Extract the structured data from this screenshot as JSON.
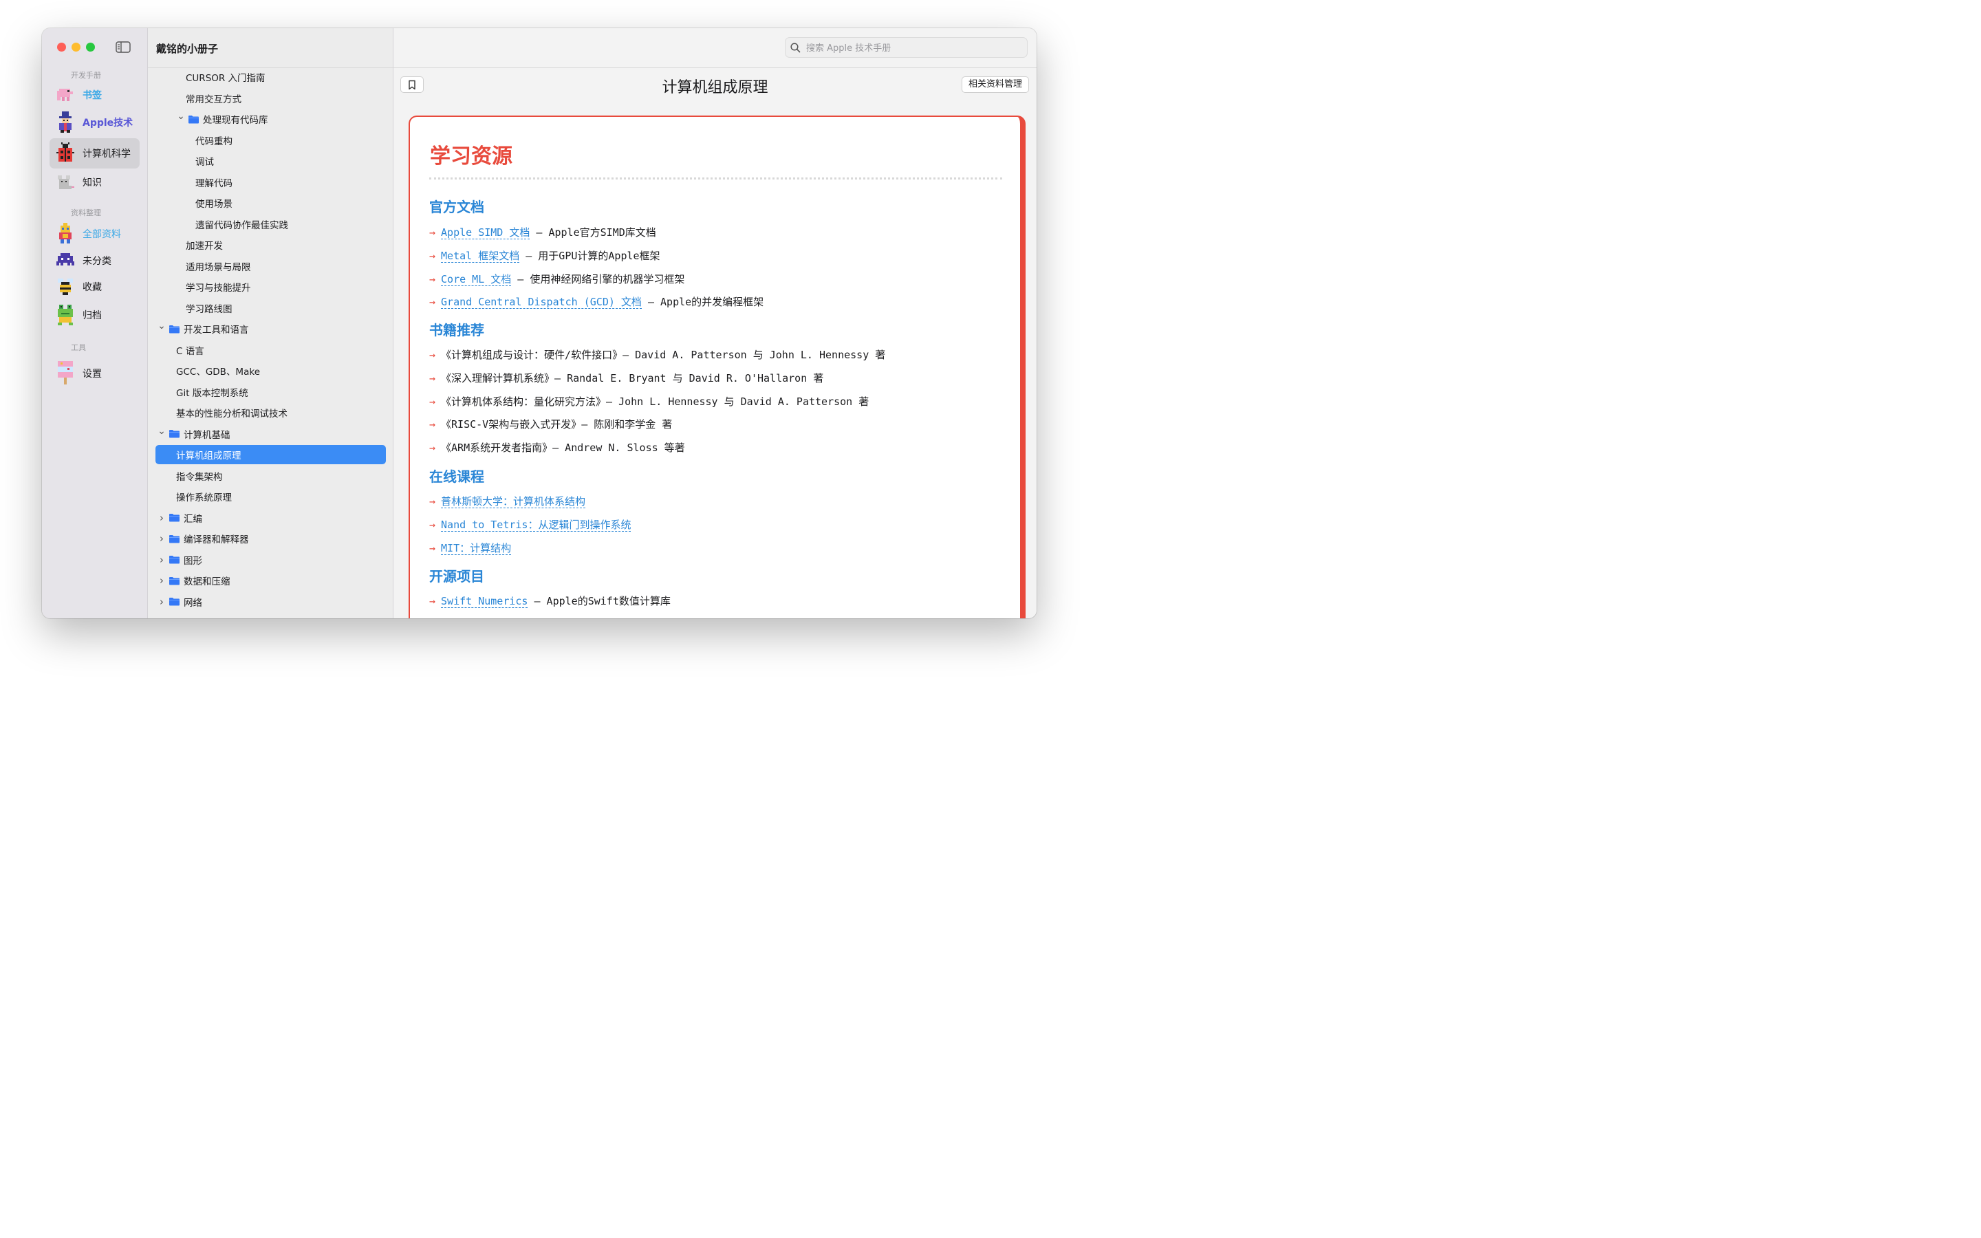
{
  "colors": {
    "accent_red": "#e84a3c",
    "link_blue": "#2a86d6",
    "selection_blue": "#3b8cf5"
  },
  "nav": {
    "section_dev": "开发手册",
    "section_materials": "资料整理",
    "section_tools": "工具",
    "items": [
      {
        "label": "书签",
        "icon": "elephant-pixel-icon"
      },
      {
        "label": "Apple技术",
        "icon": "wizard-pixel-icon"
      },
      {
        "label": "计算机科学",
        "icon": "ladybug-pixel-icon"
      },
      {
        "label": "知识",
        "icon": "mouse-pixel-icon"
      },
      {
        "label": "全部资料",
        "icon": "robot-pixel-icon"
      },
      {
        "label": "未分类",
        "icon": "invader-pixel-icon"
      },
      {
        "label": "收藏",
        "icon": "bee-pixel-icon"
      },
      {
        "label": "归档",
        "icon": "frog-pixel-icon"
      },
      {
        "label": "设置",
        "icon": "popsicle-pixel-icon"
      }
    ]
  },
  "app_title": "戴铭的小册子",
  "search": {
    "placeholder": "搜索 Apple 技术手册"
  },
  "tree": [
    {
      "label": "CURSOR 入门指南"
    },
    {
      "label": "常用交互方式"
    },
    {
      "label": "处理现有代码库",
      "folder": true,
      "expanded": true
    },
    {
      "label": "代码重构"
    },
    {
      "label": "调试"
    },
    {
      "label": "理解代码"
    },
    {
      "label": "使用场景"
    },
    {
      "label": "遗留代码协作最佳实践"
    },
    {
      "label": "加速开发"
    },
    {
      "label": "适用场景与局限"
    },
    {
      "label": "学习与技能提升"
    },
    {
      "label": "学习路线图"
    },
    {
      "label": "开发工具和语言",
      "folder": true,
      "expanded": true
    },
    {
      "label": "C 语言"
    },
    {
      "label": "GCC、GDB、Make"
    },
    {
      "label": "Git 版本控制系统"
    },
    {
      "label": "基本的性能分析和调试技术"
    },
    {
      "label": "计算机基础",
      "folder": true,
      "expanded": true
    },
    {
      "label": "计算机组成原理",
      "selected": true
    },
    {
      "label": "指令集架构"
    },
    {
      "label": "操作系统原理"
    },
    {
      "label": "汇编",
      "folder": true,
      "expanded": false
    },
    {
      "label": "编译器和解释器",
      "folder": true,
      "expanded": false
    },
    {
      "label": "图形",
      "folder": true,
      "expanded": false
    },
    {
      "label": "数据和压缩",
      "folder": true,
      "expanded": false
    },
    {
      "label": "网络",
      "folder": true,
      "expanded": false
    }
  ],
  "doc": {
    "title": "计算机组成原理",
    "manage_button": "相关资料管理",
    "heading": "学习资源",
    "sections": [
      {
        "title": "官方文档",
        "items": [
          {
            "link": "Apple SIMD 文档",
            "text": " – Apple官方SIMD库文档"
          },
          {
            "link": "Metal 框架文档",
            "text": " – 用于GPU计算的Apple框架"
          },
          {
            "link": "Core ML 文档",
            "text": " – 使用神经网络引擎的机器学习框架"
          },
          {
            "link": "Grand Central Dispatch (GCD) 文档",
            "text": " – Apple的并发编程框架"
          }
        ]
      },
      {
        "title": "书籍推荐",
        "items": [
          {
            "link": "",
            "text": "《计算机组成与设计：硬件/软件接口》– David A. Patterson 与 John L. Hennessy 著"
          },
          {
            "link": "",
            "text": "《深入理解计算机系统》– Randal E. Bryant 与 David R. O'Hallaron 著"
          },
          {
            "link": "",
            "text": "《计算机体系结构：量化研究方法》– John L. Hennessy 与 David A. Patterson 著"
          },
          {
            "link": "",
            "text": "《RISC-V架构与嵌入式开发》– 陈刚和李学金 著"
          },
          {
            "link": "",
            "text": "《ARM系统开发者指南》– Andrew N. Sloss 等著"
          }
        ]
      },
      {
        "title": "在线课程",
        "items": [
          {
            "link": "普林斯顿大学：计算机体系结构",
            "text": ""
          },
          {
            "link": "Nand to Tetris：从逻辑门到操作系统",
            "text": ""
          },
          {
            "link": "MIT：计算结构",
            "text": ""
          }
        ]
      },
      {
        "title": "开源项目",
        "items": [
          {
            "link": "Swift Numerics",
            "text": " – Apple的Swift数值计算库"
          }
        ]
      }
    ]
  }
}
